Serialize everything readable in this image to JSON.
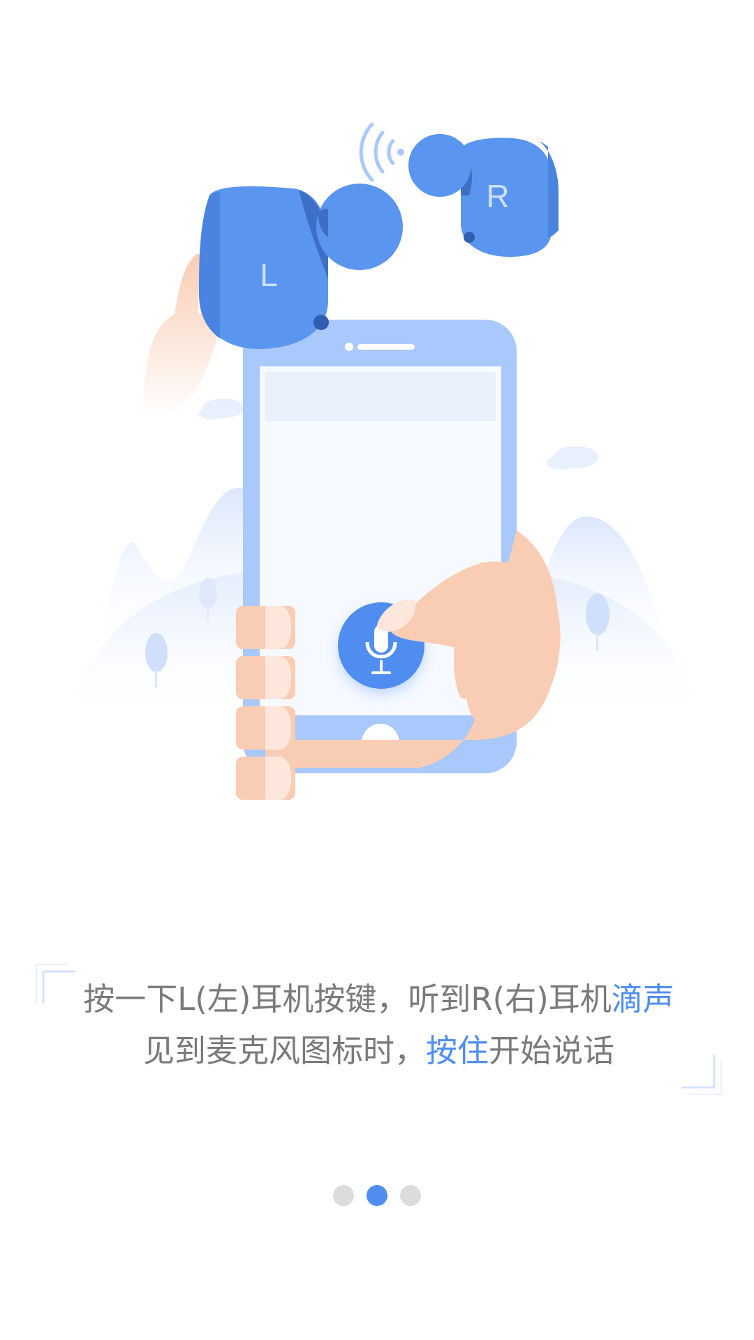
{
  "earbuds": {
    "left_label": "L",
    "right_label": "R"
  },
  "instruction": {
    "line1_part1": "按一下L(左)耳机按键，听到R(右)耳机",
    "line1_highlight": "滴声",
    "line2_part1": "见到麦克风图标时，",
    "line2_highlight": "按住",
    "line2_part2": "开始说话"
  },
  "pager": {
    "total": 3,
    "active_index": 1
  },
  "colors": {
    "accent": "#4f8ef0",
    "earbud": "#5a95ef",
    "phone_frame": "#a9c8fb",
    "skin": "#f9cdb4",
    "text": "#7a7a7a",
    "dot_inactive": "#dcdcdc"
  },
  "icons": [
    "microphone-icon",
    "sound-wave-icon",
    "cloud-icon",
    "tree-icon",
    "home-button-icon"
  ]
}
